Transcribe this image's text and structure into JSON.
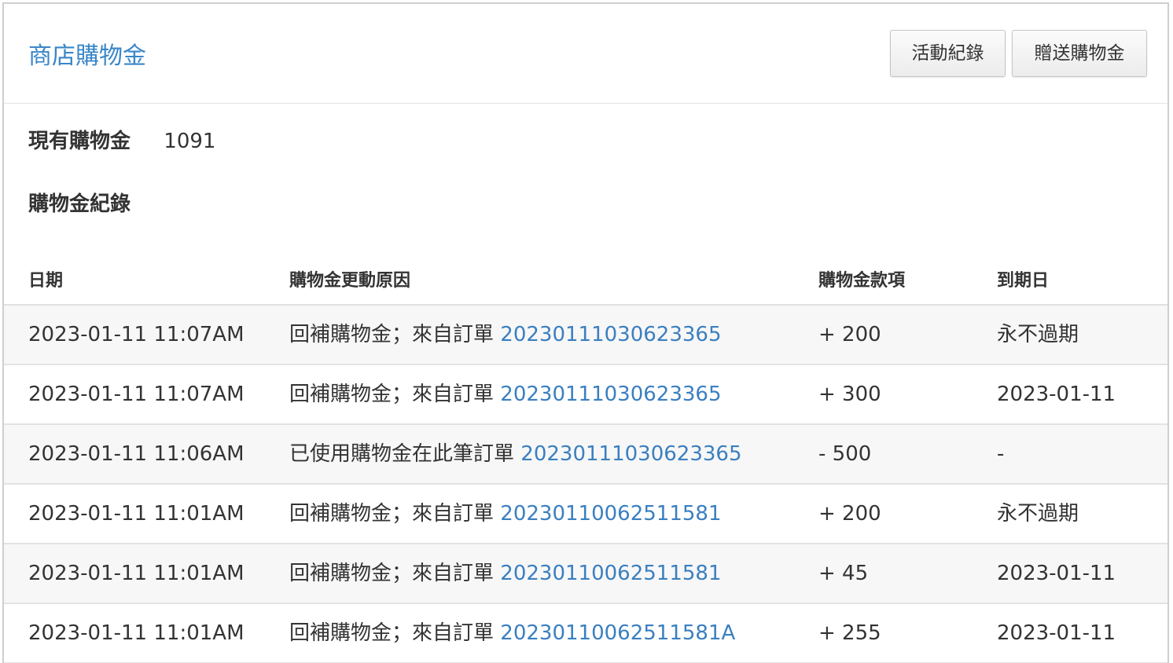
{
  "header": {
    "title": "商店購物金",
    "activity_log_button": "活動紀錄",
    "gift_button": "贈送購物金"
  },
  "balance": {
    "label": "現有購物金",
    "value": "1091"
  },
  "records_section": {
    "title": "購物金紀錄"
  },
  "table": {
    "columns": [
      "日期",
      "購物金更動原因",
      "購物金款項",
      "到期日"
    ],
    "rows": [
      {
        "date": "2023-01-11 11:07AM",
        "reason": "回補購物金；來自訂單",
        "order": "20230111030623365",
        "amount": "+ 200",
        "expiry": "永不過期"
      },
      {
        "date": "2023-01-11 11:07AM",
        "reason": "回補購物金；來自訂單",
        "order": "20230111030623365",
        "amount": "+ 300",
        "expiry": "2023-01-11"
      },
      {
        "date": "2023-01-11 11:06AM",
        "reason": "已使用購物金在此筆訂單",
        "order": "20230111030623365",
        "amount": "- 500",
        "expiry": "-"
      },
      {
        "date": "2023-01-11 11:01AM",
        "reason": "回補購物金；來自訂單",
        "order": "20230110062511581",
        "amount": "+ 200",
        "expiry": "永不過期"
      },
      {
        "date": "2023-01-11 11:01AM",
        "reason": "回補購物金；來自訂單",
        "order": "20230110062511581",
        "amount": "+ 45",
        "expiry": "2023-01-11"
      },
      {
        "date": "2023-01-11 11:01AM",
        "reason": "回補購物金；來自訂單",
        "order": "20230110062511581A",
        "amount": "+ 255",
        "expiry": "2023-01-11"
      }
    ]
  },
  "colors": {
    "accent": "#3a86c8",
    "link": "#3a7fc0",
    "text": "#333333",
    "row_alt": "#f7f7f7"
  }
}
